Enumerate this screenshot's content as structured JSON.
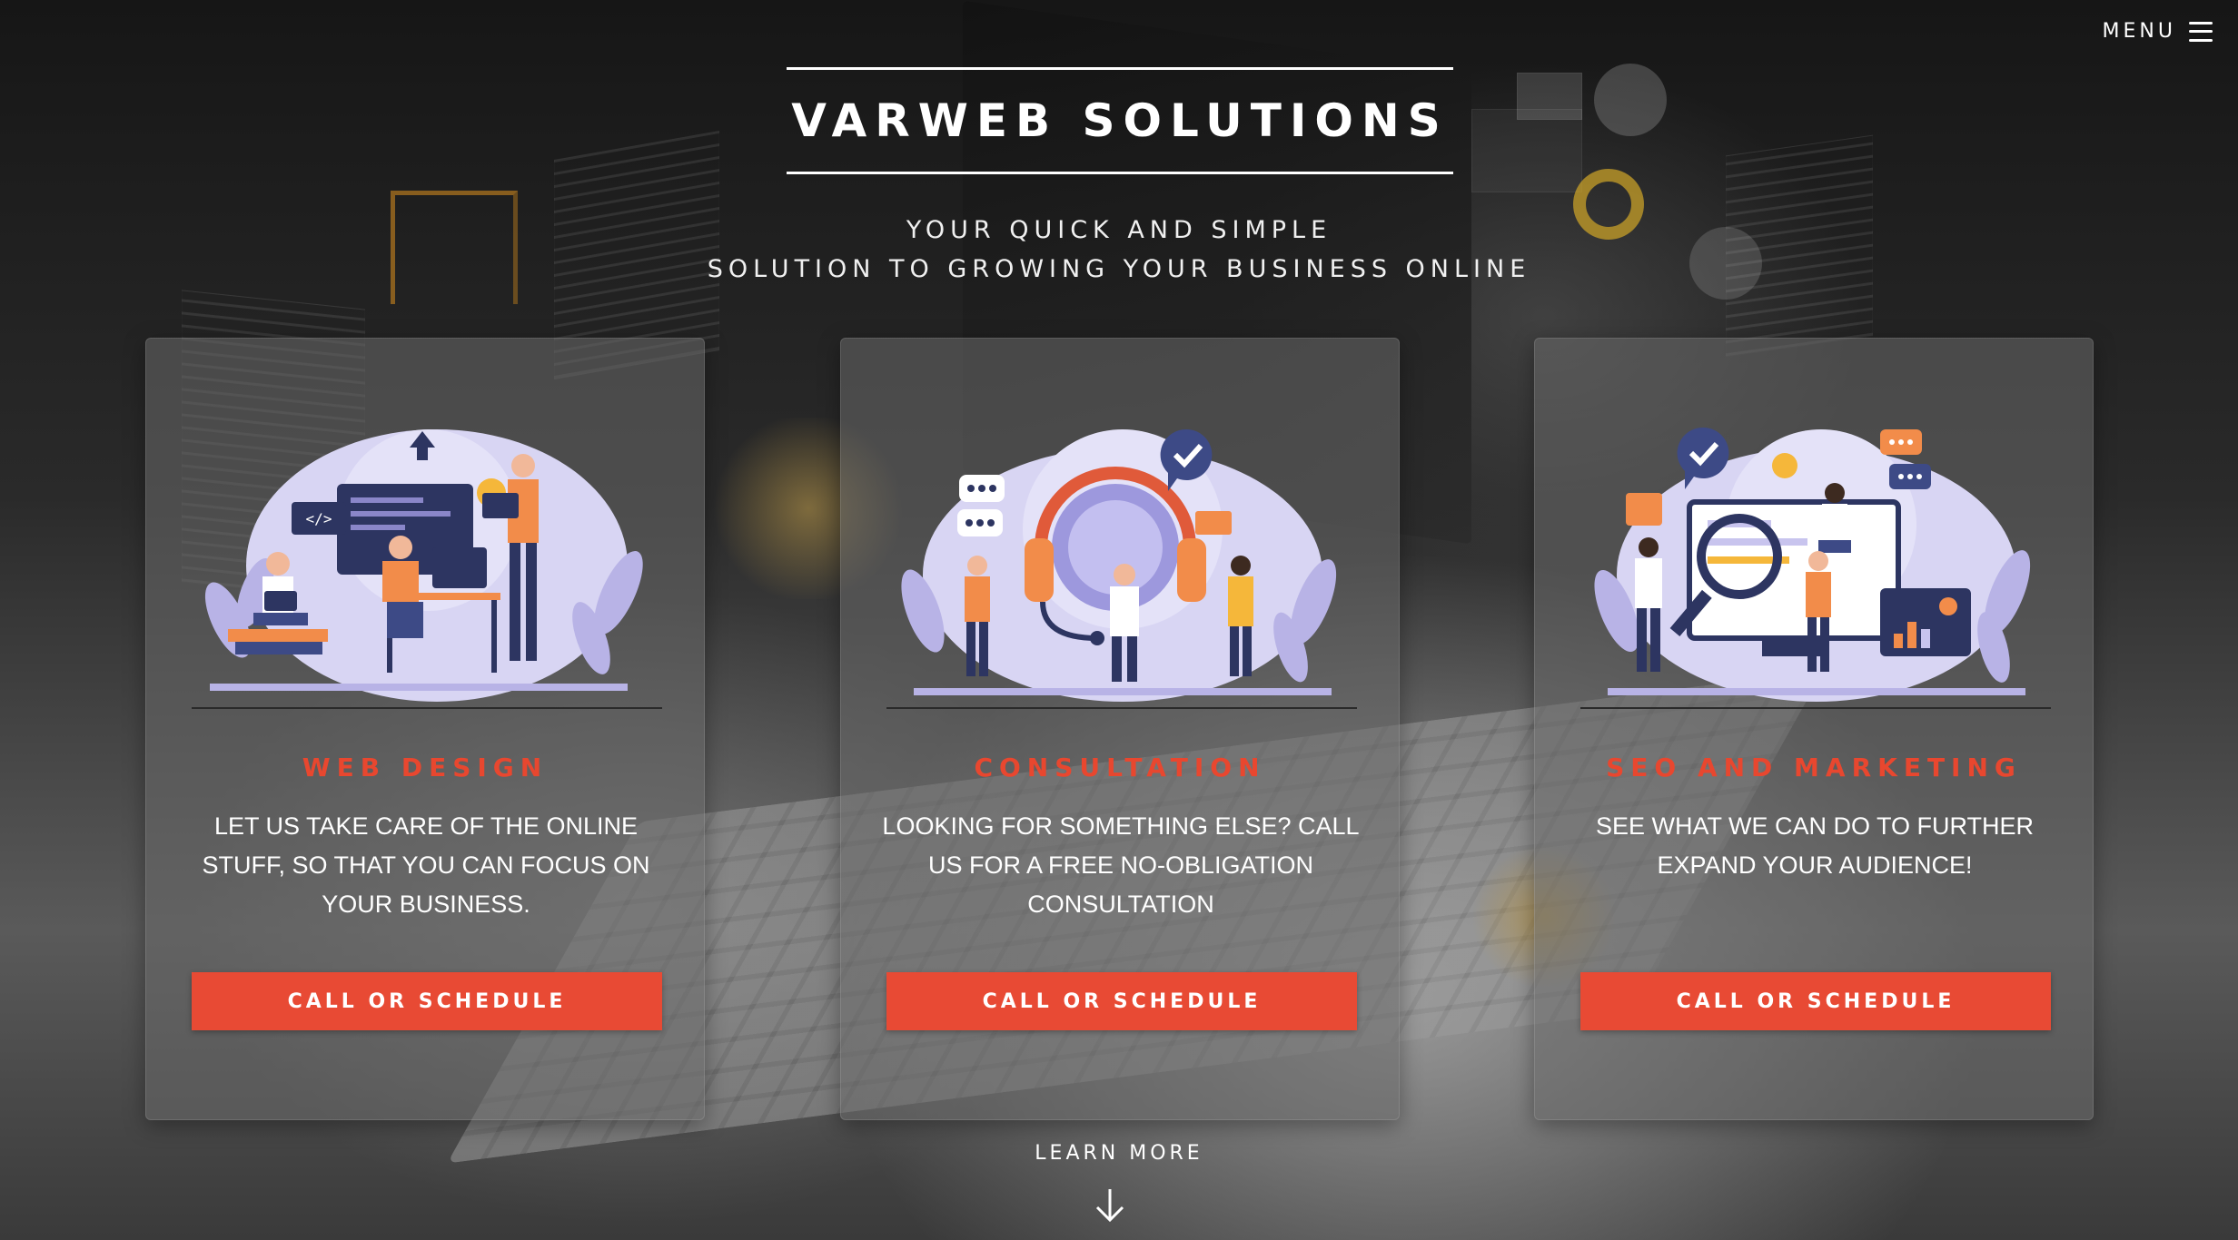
{
  "header": {
    "menu_label": "MENU",
    "title": "VARWEB SOLUTIONS",
    "tagline_line1": "YOUR QUICK AND SIMPLE",
    "tagline_line2": "SOLUTION TO GROWING YOUR BUSINESS ONLINE"
  },
  "cards": [
    {
      "title": "WEB DESIGN",
      "text": "LET US TAKE CARE OF THE ONLINE STUFF, SO THAT YOU CAN FOCUS ON YOUR BUSINESS.",
      "button": "CALL OR SCHEDULE",
      "illustration": "web-design-illustration"
    },
    {
      "title": "CONSULTATION",
      "text": "LOOKING FOR SOMETHING ELSE? CALL US FOR A FREE NO-OBLIGATION CONSULTATION",
      "button": "CALL OR SCHEDULE",
      "illustration": "consultation-illustration"
    },
    {
      "title": "SEO AND MARKETING",
      "text": "SEE WHAT WE CAN DO TO FURTHER EXPAND YOUR AUDIENCE!",
      "button": "CALL OR SCHEDULE",
      "illustration": "seo-marketing-illustration"
    }
  ],
  "footer": {
    "learn_more": "LEARN MORE",
    "arrow_icon": "arrow-down-icon"
  },
  "colors": {
    "accent": "#e84a34",
    "card_bg": "rgba(105,105,105,0.55)",
    "illustration_lavender": "#c8c4ee",
    "illustration_navy": "#2d3561",
    "illustration_orange": "#f28c4a"
  }
}
